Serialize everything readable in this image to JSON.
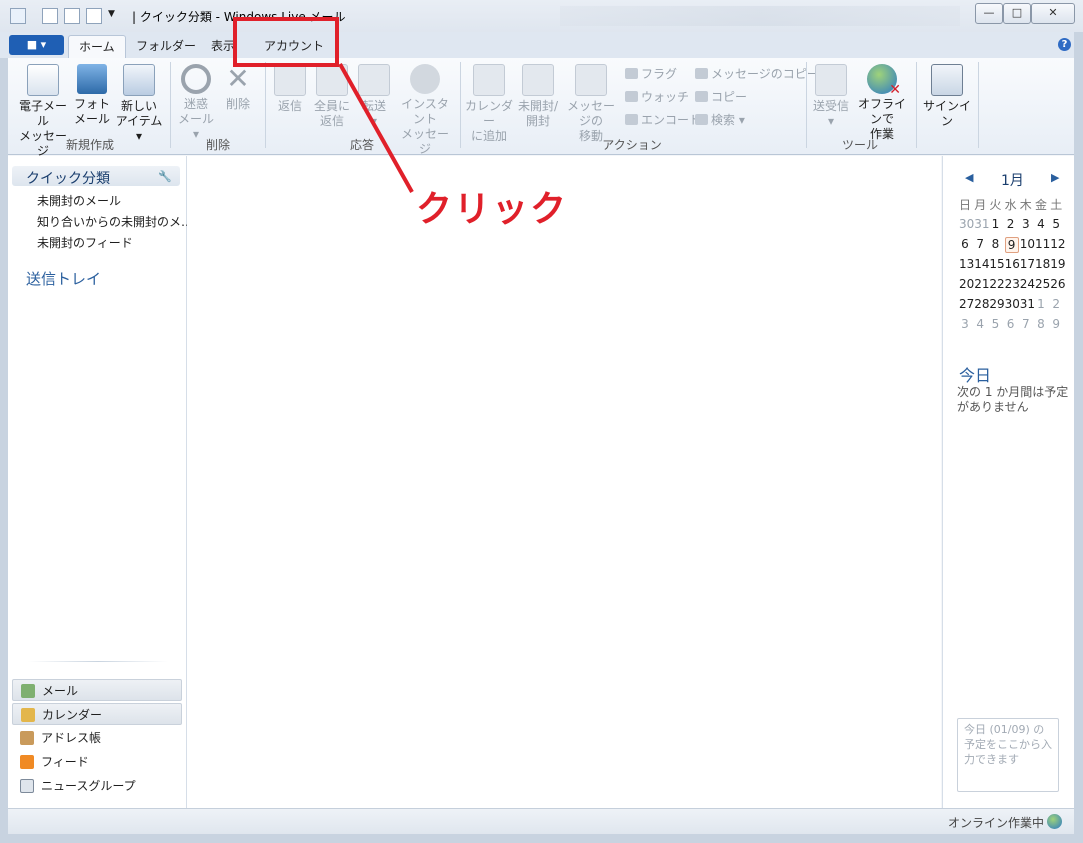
{
  "title_bar": {
    "title": "| クイック分類 - Windows Live メール",
    "minimize": "—",
    "maximize": "□",
    "close": "✕"
  },
  "app_menu": {
    "label": "■ ▾"
  },
  "tabs": [
    {
      "label": "ホーム",
      "active": true
    },
    {
      "label": "フォルダー",
      "active": false
    },
    {
      "label": "表示",
      "active": false
    },
    {
      "label": "アカウント",
      "active": false
    }
  ],
  "help": "?",
  "ribbon": {
    "new": {
      "group_label": "新規作成",
      "email": "電子メール\nメッセージ",
      "photo": "フォト\nメール",
      "new_items": "新しい\nアイテム ▾"
    },
    "delete": {
      "group_label": "削除",
      "junk": "迷惑\nメール ▾",
      "delete": "削除"
    },
    "respond": {
      "group_label": "応答",
      "reply": "返信",
      "reply_all": "全員に\n返信",
      "forward": "転送\n▾",
      "im": "インスタント\nメッセージ"
    },
    "actions": {
      "group_label": "アクション",
      "add_to_calendar": "カレンダー\nに追加",
      "unread": "未開封/\n開封",
      "move": "メッセージの\n移動",
      "flag": "フラグ",
      "watch": "ウォッチ",
      "encode": "エンコード",
      "copy_message": "メッセージのコピー",
      "copy": "コピー",
      "find": "検索 ▾"
    },
    "tools": {
      "group_label": "ツール",
      "send_receive": "送受信\n▾",
      "work_offline": "オフラインで\n作業"
    },
    "sign_in": "サインイン"
  },
  "left_pane": {
    "quick_views_title": "クイック分類",
    "quick_views": [
      "未開封のメール",
      "知り合いからの未開封のメ…",
      "未開封のフィード"
    ],
    "outbox": "送信トレイ",
    "nav": [
      {
        "label": "メール",
        "icon": "mail-icon",
        "selected": true
      },
      {
        "label": "カレンダー",
        "icon": "calendar-icon",
        "selected": true
      },
      {
        "label": "アドレス帳",
        "icon": "contacts-icon",
        "selected": false
      },
      {
        "label": "フィード",
        "icon": "feed-icon",
        "selected": false
      },
      {
        "label": "ニュースグループ",
        "icon": "newsgroup-icon",
        "selected": false
      }
    ]
  },
  "calendar": {
    "month": "1月",
    "prev": "◀",
    "next": "▶",
    "weekdays": [
      "日",
      "月",
      "火",
      "水",
      "木",
      "金",
      "土"
    ],
    "weeks": [
      [
        "30",
        "31",
        "1",
        "2",
        "3",
        "4",
        "5"
      ],
      [
        "6",
        "7",
        "8",
        "9",
        "10",
        "11",
        "12"
      ],
      [
        "13",
        "14",
        "15",
        "16",
        "17",
        "18",
        "19"
      ],
      [
        "20",
        "21",
        "22",
        "23",
        "24",
        "25",
        "26"
      ],
      [
        "27",
        "28",
        "29",
        "30",
        "31",
        "1",
        "2"
      ],
      [
        "3",
        "4",
        "5",
        "6",
        "7",
        "8",
        "9"
      ]
    ],
    "today_day": "9",
    "today_title": "今日",
    "today_note": "次の 1 か月間は予定がありません",
    "quick_add_placeholder": "今日 (01/09) の予定をここから入力できます"
  },
  "status_bar": {
    "text": "オンライン作業中"
  },
  "annotation": {
    "label": "クリック",
    "color": "#e0202a"
  },
  "colors": {
    "accent": "#1f5fb4",
    "link": "#2a5f9e",
    "annotation": "#e0202a"
  }
}
